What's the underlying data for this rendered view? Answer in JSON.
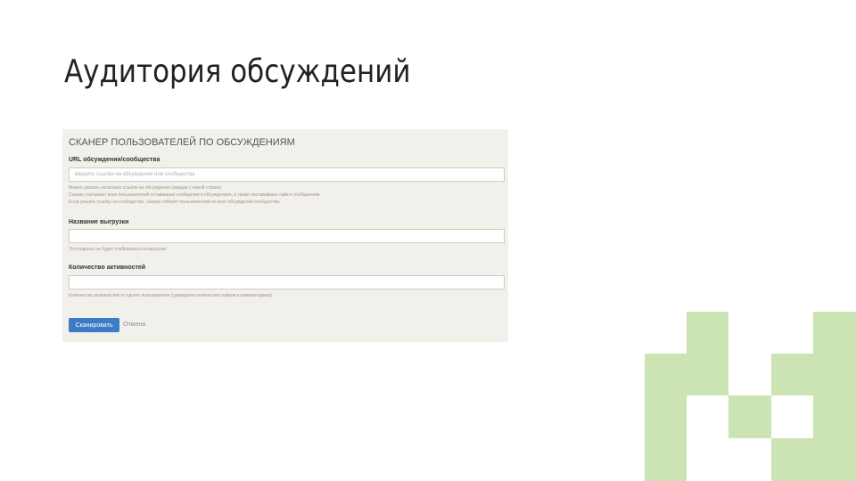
{
  "slide": {
    "title": "Аудитория обсуждений"
  },
  "scanner": {
    "header": "СКАНЕР ПОЛЬЗОВАТЕЛЕЙ ПО ОБСУЖДЕНИЯМ",
    "url_field": {
      "label": "URL обсуждения/сообщества",
      "placeholder": "введите ссылки на обсуждения или сообщества",
      "help_lines": [
        "Можно указать несколько ссылок на обсуждения (каждая с новой строки).",
        "Сканер учитывает всех пользователей оставивших сообщения в обсуждениях, а также поставивших лайк к сообщениям.",
        "Если указать ссылку на сообщество, сканер соберёт пользователей из всех обсуждений сообщества."
      ]
    },
    "name_field": {
      "label": "Название выгрузки",
      "value": "",
      "help": "Эта подпись не будет отображаться в выгрузке"
    },
    "count_field": {
      "label": "Количество активностей",
      "value": "",
      "help": "Количество активностей от одного пользователя (суммарное количество лайков и комментариев)"
    },
    "scan_button": "Сканировать",
    "cancel_link": "Отмена"
  },
  "colors": {
    "panel_bg": "#f2f0ea",
    "button_bg": "#3c7cc4",
    "decor_green": "#cce3b3"
  }
}
